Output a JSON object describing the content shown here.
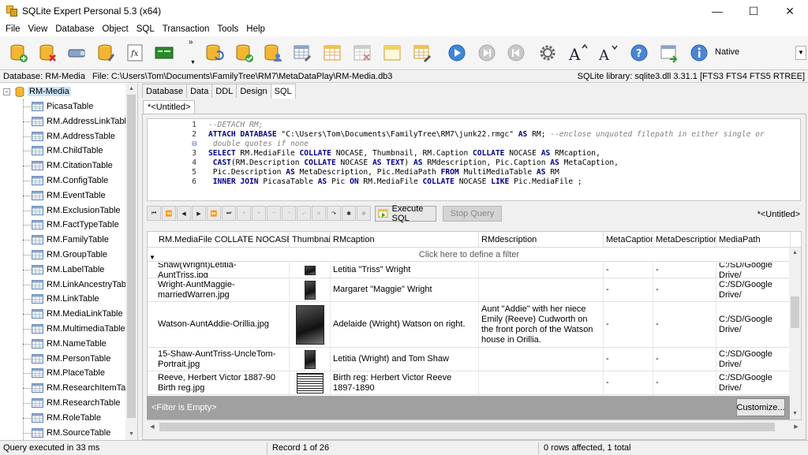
{
  "window": {
    "title": "SQLite Expert Personal 5.3 (x64)",
    "minimize": "—",
    "maximize": "☐",
    "close": "✕"
  },
  "menu": [
    "File",
    "View",
    "Database",
    "Object",
    "SQL",
    "Transaction",
    "Tools",
    "Help"
  ],
  "toolbar": {
    "overflow": "»",
    "native_label": "Native",
    "icons": [
      "new-database-icon",
      "delete-database-icon",
      "attach-icon",
      "open-database-icon",
      "function-icon",
      "terminal-icon",
      "refresh-icon",
      "check-database-icon",
      "user-database-icon",
      "table-design-icon",
      "table-icon",
      "delete-table-icon",
      "folder-table-icon",
      "edit-table-icon",
      "play-icon",
      "skip-icon",
      "back-icon",
      "settings-icon",
      "font-larger-icon",
      "font-smaller-icon",
      "help-icon",
      "import-icon",
      "info-icon"
    ]
  },
  "pathbar": {
    "database": "Database: RM-Media",
    "file": "File: C:\\Users\\Tom\\Documents\\FamilyTree\\RM7\\MetaDataPlay\\RM-Media.db3",
    "library": "SQLite library: sqlite3.dll 3.31.1 [FTS3 FTS4 FTS5 RTREE]"
  },
  "tree": {
    "root": "RM-Media",
    "expander": "−",
    "items": [
      "PicasaTable",
      "RM.AddressLinkTable",
      "RM.AddressTable",
      "RM.ChildTable",
      "RM.CitationTable",
      "RM.ConfigTable",
      "RM.EventTable",
      "RM.ExclusionTable",
      "RM.FactTypeTable",
      "RM.FamilyTable",
      "RM.GroupTable",
      "RM.LabelTable",
      "RM.LinkAncestryTable",
      "RM.LinkTable",
      "RM.MediaLinkTable",
      "RM.MultimediaTable",
      "RM.NameTable",
      "RM.PersonTable",
      "RM.PlaceTable",
      "RM.ResearchItemTable",
      "RM.ResearchTable",
      "RM.RoleTable",
      "RM.SourceTable"
    ]
  },
  "tabs": [
    "Database",
    "Data",
    "DDL",
    "Design",
    "SQL"
  ],
  "subtab": "*<Untitled>",
  "editor": {
    "gutter": [
      "1",
      "2",
      "",
      "3",
      "4",
      "5",
      "6"
    ],
    "fold_marker": "⊟"
  },
  "nav": {
    "buttons": [
      "⏮",
      "⏪",
      "◀",
      "▶",
      "⏩",
      "⏭",
      "+",
      "+",
      "−",
      "−",
      "✓",
      "✕",
      "↷",
      "✱",
      "✱"
    ],
    "execute": "Execute SQL",
    "stop": "Stop Query",
    "untitled": "*<Untitled>"
  },
  "grid": {
    "columns": [
      "RM.MediaFile COLLATE NOCASE",
      "Thumbnail",
      "RMcaption",
      "RMdescription",
      "MetaCaption",
      "MetaDescription",
      "MediaPath"
    ],
    "filter_hint": "Click here to define a filter",
    "rows": [
      {
        "file": "Shaw(Wright)Letitia-AuntTriss.jpg",
        "caption": "Letitia \"Triss\" Wright",
        "description": "",
        "meta_caption": "-",
        "meta_description": "-",
        "path": "C:/SD/Google Drive/"
      },
      {
        "file": "Wright-AuntMaggie-marriedWarren.jpg",
        "caption": "Margaret \"Maggie\" Wright",
        "description": "",
        "meta_caption": "-",
        "meta_description": "-",
        "path": "C:/SD/Google Drive/"
      },
      {
        "file": "Watson-AuntAddie-Orillia.jpg",
        "caption": "Adelaide (Wright) Watson on right.",
        "description": "Aunt \"Addie\" with her niece Emily (Reeve) Cudworth on the front porch of the Watson house in Orillia.",
        "meta_caption": "-",
        "meta_description": "-",
        "path": "C:/SD/Google Drive/"
      },
      {
        "file": "15-Shaw-AuntTriss-UncleTom-Portrait.jpg",
        "caption": "Letitia (Wright) and Tom Shaw",
        "description": "",
        "meta_caption": "-",
        "meta_description": "-",
        "path": "C:/SD/Google Drive/"
      },
      {
        "file": "Reeve, Herbert Victor 1887-90 Birth reg.jpg",
        "caption": "Birth reg: Herbert Victor Reeve 1897-1890",
        "description": "",
        "meta_caption": "-",
        "meta_description": "-",
        "path": "C:/SD/Google Drive/"
      }
    ],
    "filter_status": "<Filter is Empty>",
    "customize": "Customize..."
  },
  "status": {
    "message": "Query executed in 33 ms",
    "record": "Record 1 of 26",
    "affected": "0 rows affected, 1 total"
  }
}
